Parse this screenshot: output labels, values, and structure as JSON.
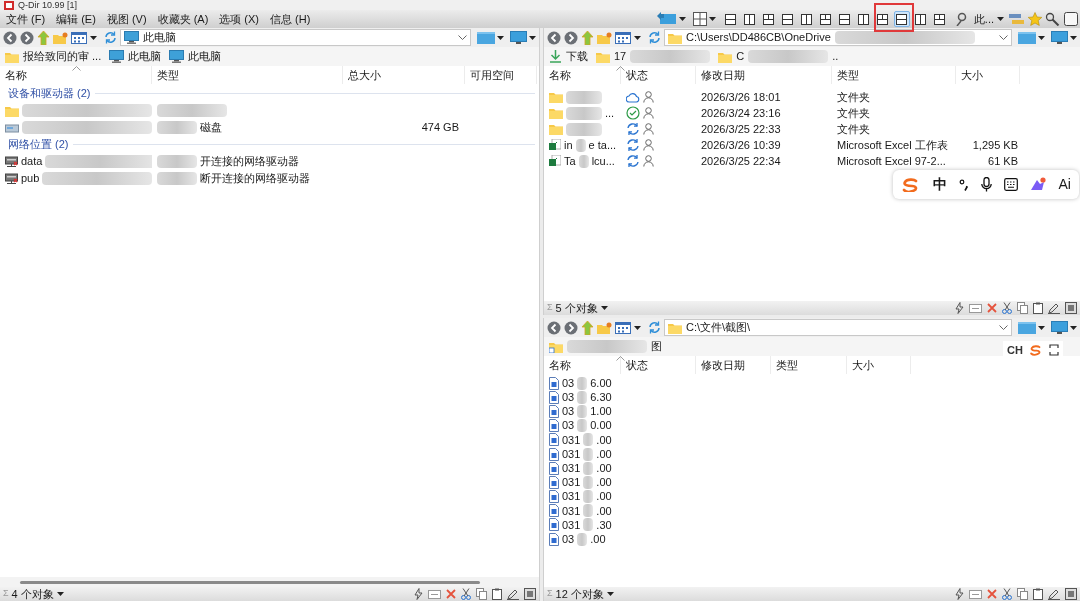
{
  "window": {
    "title": "Q-Dir 10.99 [1]"
  },
  "menu": [
    "文件 (F)",
    "编辑 (E)",
    "视图 (V)",
    "收藏夹 (A)",
    "选项 (X)",
    "信息 (H)"
  ],
  "toolbar": {
    "layouts": [
      {
        "selected": false
      },
      {
        "selected": false
      },
      {
        "selected": false
      },
      {
        "selected": false
      },
      {
        "selected": false
      },
      {
        "selected": false
      },
      {
        "selected": false
      },
      {
        "selected": false
      },
      {
        "selected": false
      },
      {
        "selected": true
      },
      {
        "selected": false
      },
      {
        "selected": false
      }
    ],
    "profile_label": "此..."
  },
  "panes": [
    {
      "kind": "drives",
      "address": {
        "text": "此电脑",
        "kind": "pc"
      },
      "breadcrumbs": [
        {
          "kind": "folder",
          "label": "报给致同的审 ..."
        },
        {
          "kind": "pc",
          "label": "此电脑"
        },
        {
          "kind": "pc",
          "label": "此电脑"
        }
      ],
      "columns": [
        "名称",
        "类型",
        "总大小",
        "可用空间"
      ],
      "groups": [
        {
          "label": "设备和驱动器 (2)",
          "rows": [
            {
              "kind": "folder"
            },
            {
              "kind": "drive",
              "type": "磁盘",
              "total": "474 GB"
            }
          ]
        },
        {
          "label": "网络位置 (2)",
          "rows": [
            {
              "kind": "netdrive",
              "name_start": "data",
              "type": "开连接的网络驱动器"
            },
            {
              "kind": "netdrive",
              "name_start": "pub",
              "type": "断开连接的网络驱动器"
            }
          ]
        }
      ],
      "status": {
        "sum_mark": "Σ",
        "text": "4 个对象"
      }
    },
    {
      "kind": "files",
      "address": {
        "text": "C:\\Users\\DD486CB\\OneDrive",
        "kind": "folder",
        "blurred": true
      },
      "breadcrumbs": [
        {
          "kind": "download",
          "label": "下载"
        },
        {
          "kind": "folder",
          "label": "17",
          "blurred": true
        },
        {
          "kind": "folder",
          "label": "C",
          "blurred": true,
          "label_end": ".."
        }
      ],
      "columns": [
        "名称",
        "状态",
        "修改日期",
        "类型",
        "大小"
      ],
      "rows": [
        {
          "kind": "folder",
          "cloud_only": true,
          "synced": false,
          "modified": "2026/3/26 18:01",
          "type": "文件夹"
        },
        {
          "kind": "folder",
          "name_end": "...",
          "cloud_only": false,
          "synced": true,
          "modified": "2026/3/24 23:16",
          "type": "文件夹"
        },
        {
          "kind": "folder",
          "cloud_only": false,
          "synced": false,
          "modified": "2026/3/25 22:33",
          "type": "文件夹"
        },
        {
          "kind": "excel",
          "name_start": "in",
          "name_end": "e ta...",
          "cloud_only": false,
          "synced": false,
          "modified": "2026/3/26 10:39",
          "type": "Microsoft Excel 工作表",
          "size": "1,295 KB"
        },
        {
          "kind": "excel",
          "name_start": "Ta",
          "name_end": "lcu...",
          "cloud_only": false,
          "synced": false,
          "modified": "2026/3/25 22:34",
          "type": "Microsoft Excel 97-2...",
          "size": "61 KB"
        }
      ],
      "status": {
        "sum_mark": "Σ",
        "text": "5 个对象"
      }
    },
    {
      "kind": "files",
      "address": {
        "text": "C:\\文件\\截图\\",
        "kind": "folder"
      },
      "breadcrumbs": [
        {
          "kind": "shortcut-folder",
          "blurred": true,
          "label_end": "图"
        }
      ],
      "columns": [
        "名称",
        "状态",
        "修改日期",
        "类型",
        "大小"
      ],
      "rows": [
        {
          "kind": "doc",
          "name_start": "03",
          "name_end": "6.00"
        },
        {
          "kind": "doc",
          "name_start": "03",
          "name_end": "6.30"
        },
        {
          "kind": "doc",
          "name_start": "03",
          "name_end": "1.00"
        },
        {
          "kind": "doc",
          "name_start": "03",
          "name_end": "0.00"
        },
        {
          "kind": "doc",
          "name_start": "031",
          "name_end": ".00"
        },
        {
          "kind": "doc",
          "name_start": "031",
          "name_end": ".00"
        },
        {
          "kind": "doc",
          "name_start": "031",
          "name_end": ".00"
        },
        {
          "kind": "doc",
          "name_start": "031",
          "name_end": ".00"
        },
        {
          "kind": "doc",
          "name_start": "031",
          "name_end": ".00"
        },
        {
          "kind": "doc",
          "name_start": "031",
          "name_end": ".00"
        },
        {
          "kind": "doc",
          "name_start": "031",
          "name_end": ".30"
        },
        {
          "kind": "doc",
          "name_start": "03",
          "name_end": ".00"
        }
      ],
      "status": {
        "sum_mark": "Σ",
        "text": "12 个对象"
      }
    }
  ],
  "ime_bar": {
    "labels": [
      "中",
      "Ai"
    ]
  },
  "ime_mini": {
    "label": "CH"
  }
}
